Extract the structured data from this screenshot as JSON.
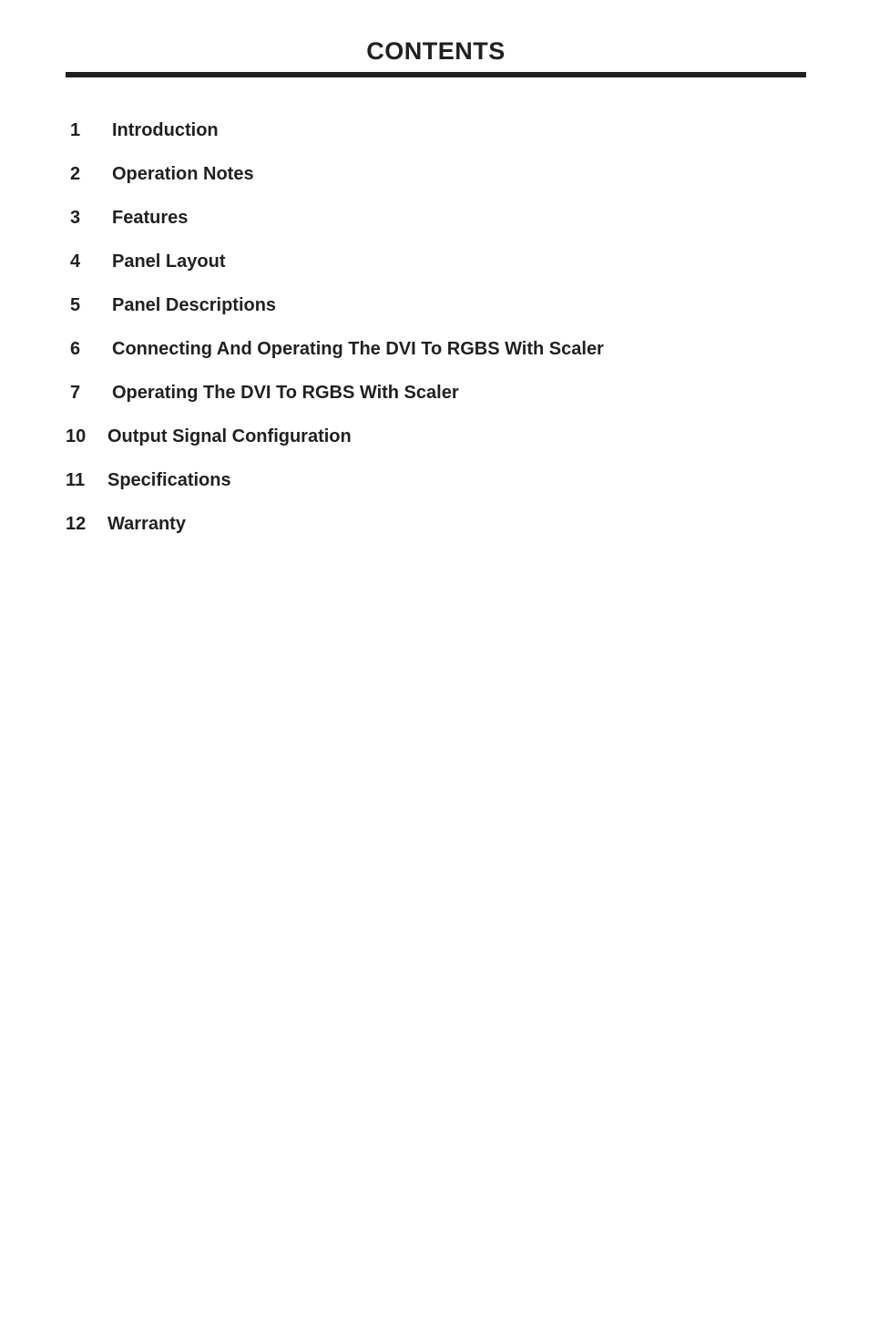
{
  "document": {
    "title": "CONTENTS",
    "text_color": "#231f20",
    "rule_color": "#231f20",
    "background_color": "#ffffff"
  },
  "contents": {
    "entries": [
      {
        "number": "1",
        "label": "Introduction"
      },
      {
        "number": "2",
        "label": "Operation Notes"
      },
      {
        "number": "3",
        "label": "Features"
      },
      {
        "number": "4",
        "label": "Panel Layout"
      },
      {
        "number": "5",
        "label": "Panel Descriptions"
      },
      {
        "number": "6",
        "label": "Connecting And Operating The DVI To RGBS With Scaler"
      },
      {
        "number": "7",
        "label": "Operating The DVI To RGBS With Scaler"
      },
      {
        "number": "10",
        "label": "Output Signal Configuration"
      },
      {
        "number": "11",
        "label": "Specifications"
      },
      {
        "number": "12",
        "label": "Warranty"
      }
    ]
  }
}
